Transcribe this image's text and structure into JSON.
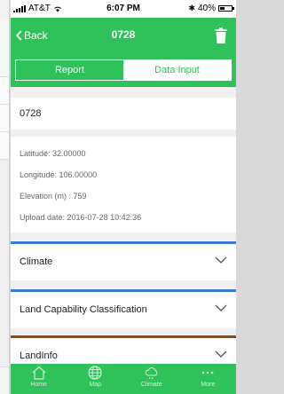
{
  "status_bar": {
    "carrier": "AT&T",
    "time": "6:07 PM",
    "battery_text": "40%",
    "battery_level": 0.4
  },
  "nav": {
    "back_label": "Back",
    "title": "0728"
  },
  "tabs_top": [
    {
      "label": "Report",
      "active": true
    },
    {
      "label": "Data Input",
      "active": false
    }
  ],
  "record": {
    "name": "0728",
    "latitude": "Latitude: 32.00000",
    "longitude": "Longitude: 106.00000",
    "elevation": "Elevation (m) : 759",
    "upload_date": "Upload date: 2016-07-28 10:42:36"
  },
  "sections": [
    {
      "label": "Climate",
      "accent": "#3a7bd5"
    },
    {
      "label": "Land Capability Classification",
      "accent": "#3a7bd5"
    },
    {
      "label": "LandInfo",
      "accent": "#7a5230"
    }
  ],
  "bottom_tabs": [
    {
      "label": "Home",
      "icon": "home-icon"
    },
    {
      "label": "Map",
      "icon": "globe-icon"
    },
    {
      "label": "Climate",
      "icon": "cloud-icon"
    },
    {
      "label": "More",
      "icon": "more-icon"
    }
  ],
  "colors": {
    "brand_green": "#2fc25b",
    "climate_bar": "#3a7bd5",
    "landinfo_bar": "#7a5230"
  }
}
